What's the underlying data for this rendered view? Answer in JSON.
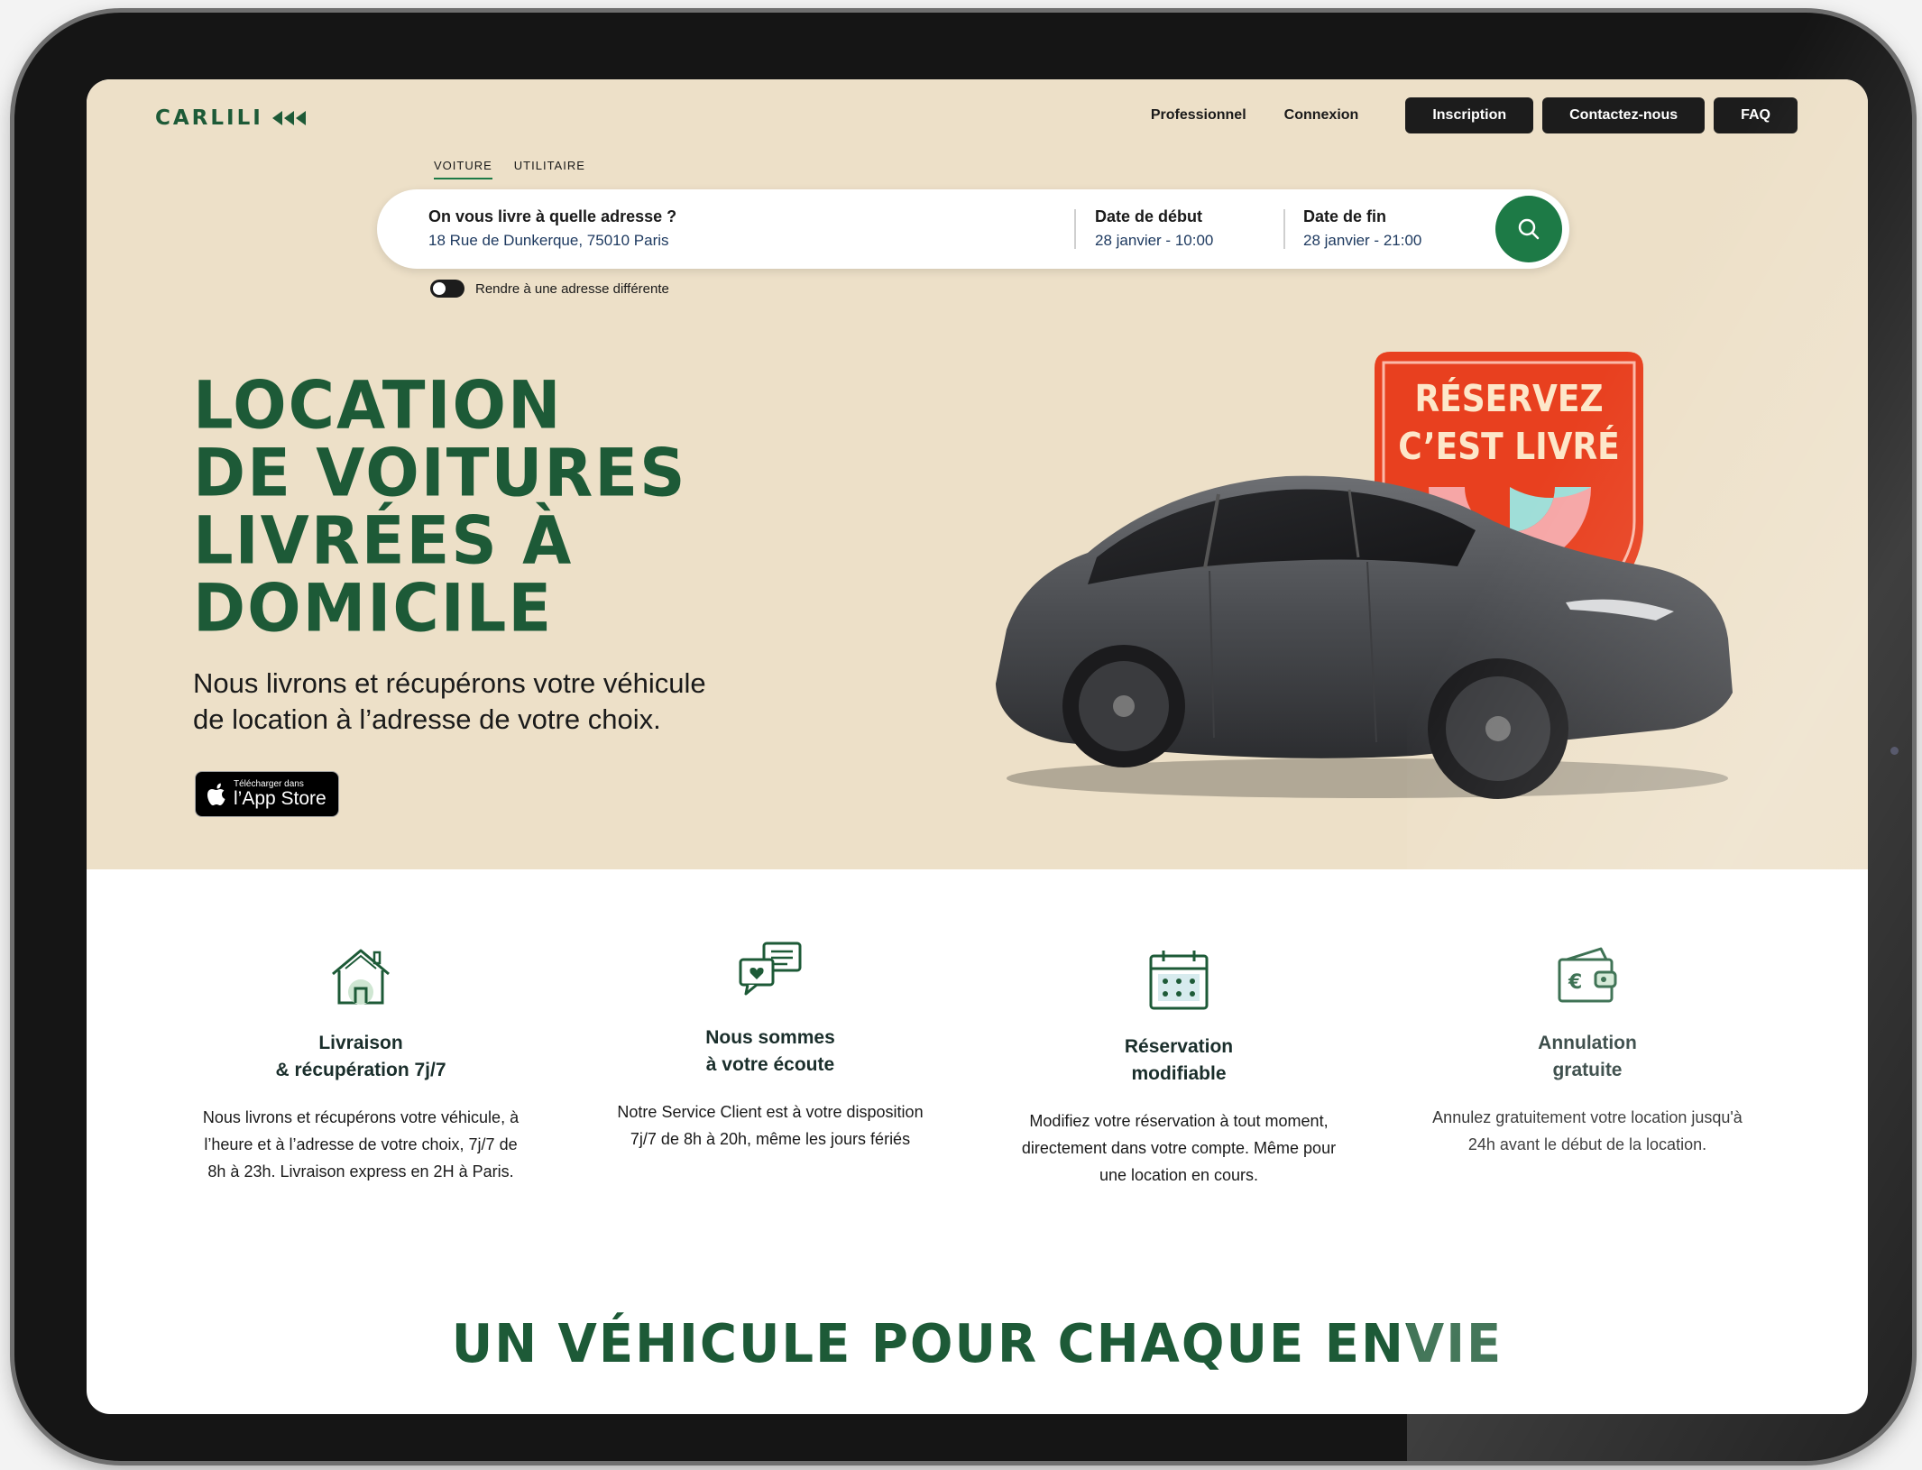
{
  "brand": {
    "logo_text": "CARLILI"
  },
  "nav": {
    "professional": "Professionnel",
    "login": "Connexion",
    "signup": "Inscription",
    "contact": "Contactez-nous",
    "faq": "FAQ"
  },
  "tabs": [
    {
      "label": "VOITURE",
      "active": true
    },
    {
      "label": "UTILITAIRE",
      "active": false
    }
  ],
  "search": {
    "address_label": "On vous livre à quelle adresse ?",
    "address_value": "18 Rue de Dunkerque, 75010 Paris",
    "start_label": "Date de début",
    "start_value": "28 janvier - 10:00",
    "end_label": "Date de fin",
    "end_value": "28 janvier - 21:00",
    "button_icon": "search-icon"
  },
  "toggle": {
    "label": "Rendre à une adresse différente",
    "on": false
  },
  "hero": {
    "title_lines": [
      "LOCATION",
      "DE VOITURES",
      "LIVRÉES À",
      "DOMICILE"
    ],
    "subtitle_line1": "Nous livrons et récupérons votre véhicule",
    "subtitle_line2": "de location à l’adresse de votre choix.",
    "appstore_small": "Télécharger dans",
    "appstore_big": "l’App Store",
    "badge_line1": "RÉSERVEZ",
    "badge_line2": "C’EST LIVRÉ"
  },
  "features": [
    {
      "icon": "house-icon",
      "title_line1": "Livraison",
      "title_line2": "& récupération 7j/7",
      "text_lines": [
        "Nous livrons et récupérons votre véhicule, à",
        "l’heure et à l’adresse de votre choix, 7j/7 de",
        "8h à 23h. Livraison express en 2H à Paris."
      ]
    },
    {
      "icon": "chat-bubbles-icon",
      "title_line1": "Nous sommes",
      "title_line2": "à votre écoute",
      "text_lines": [
        "Notre Service Client est à votre disposition",
        "7j/7 de 8h à 20h, même les jours fériés"
      ]
    },
    {
      "icon": "calendar-icon",
      "title_line1": "Réservation",
      "title_line2": "modifiable",
      "text_lines": [
        "Modifiez votre réservation à tout moment,",
        "directement dans votre compte. Même pour",
        "une location en cours."
      ]
    },
    {
      "icon": "wallet-euro-icon",
      "title_line1": "Annulation",
      "title_line2": "gratuite",
      "text_lines": [
        "Annulez gratuitement votre location jusqu'à",
        "24h avant le début de la location."
      ]
    }
  ],
  "section": {
    "title": "UN VÉHICULE POUR CHAQUE ENVIE"
  },
  "colors": {
    "brand_green": "#1d5a37",
    "accent_green": "#1d7a46",
    "hero_bg": "#ede0c8",
    "badge_red": "#e8401f"
  }
}
